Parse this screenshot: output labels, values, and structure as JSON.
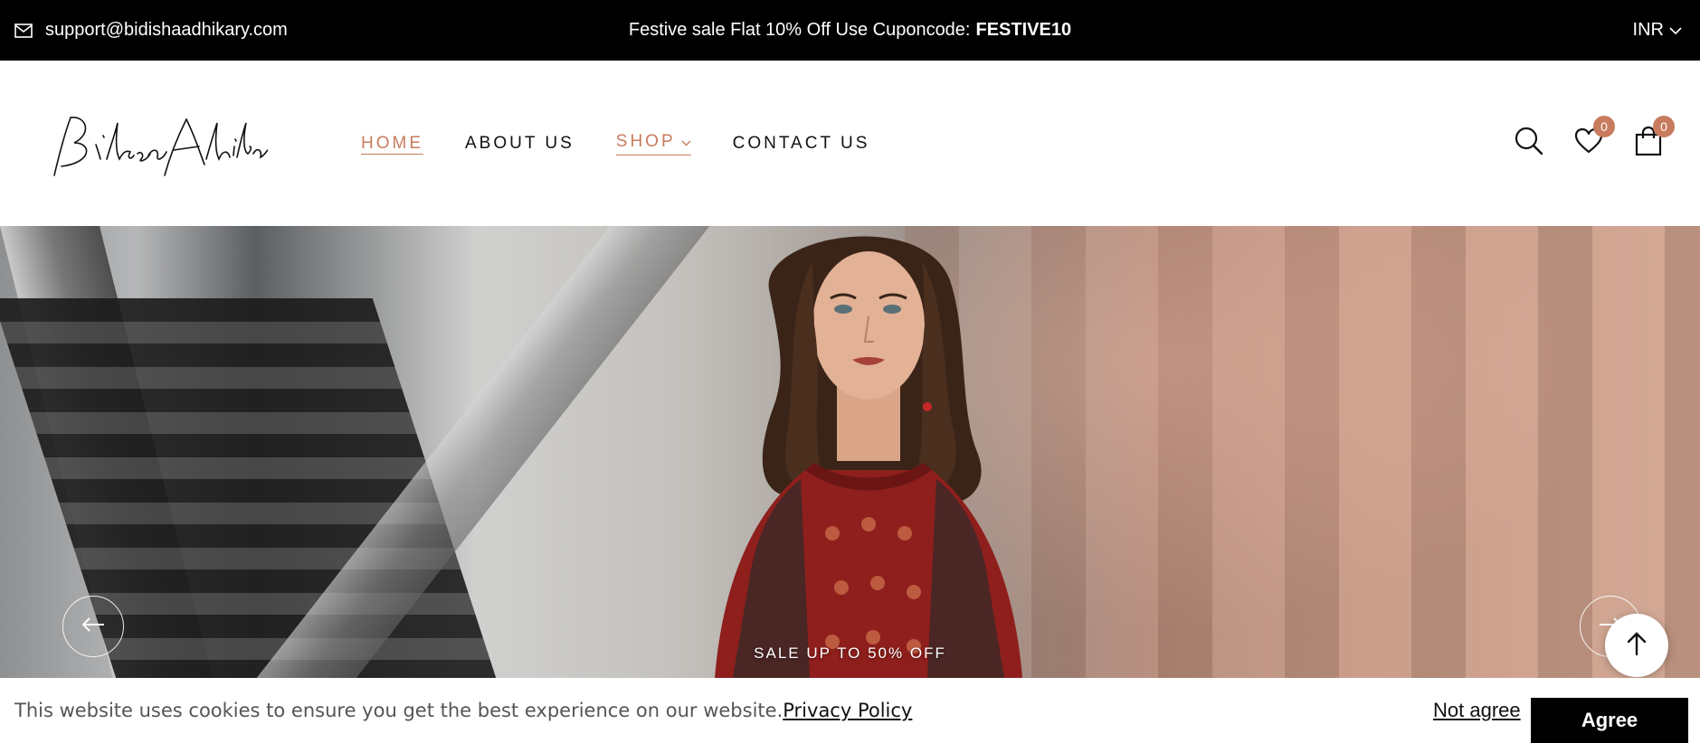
{
  "topbar": {
    "email": "support@bidishaadhikary.com",
    "promo_text": "Festive sale Flat 10% Off Use Cuponcode:",
    "promo_code": "FESTIVE10",
    "currency": "INR"
  },
  "header": {
    "logo_text": "Bidisha Adhikary",
    "nav": [
      {
        "label": "HOME"
      },
      {
        "label": "ABOUT US"
      },
      {
        "label": "SHOP"
      },
      {
        "label": "CONTACT US"
      }
    ],
    "wishlist_count": "0",
    "cart_count": "0"
  },
  "hero": {
    "caption": "SALE UP TO 50% OFF"
  },
  "cookie": {
    "message": "This website uses cookies to ensure you get the best experience on our website.",
    "policy_link": "Privacy Policy",
    "not_agree": "Not agree",
    "agree": "Agree"
  },
  "colors": {
    "accent": "#c97b5e",
    "topbar_bg": "#000000"
  }
}
